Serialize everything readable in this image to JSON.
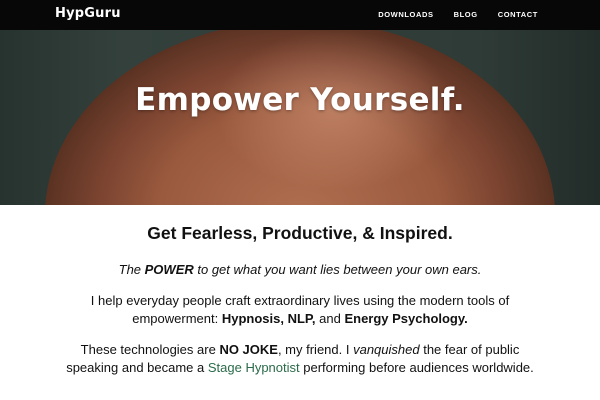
{
  "navbar": {
    "brand": "HypGuru",
    "links": [
      "DOWNLOADS",
      "BLOG",
      "CONTACT"
    ]
  },
  "hero": {
    "title": "Empower Yourself."
  },
  "main": {
    "headline": "Get Fearless, Productive, & Inspired.",
    "tagline": {
      "pre": "The ",
      "bold": "POWER",
      "post": " to get what you want lies between your own ears."
    },
    "intro": {
      "pre": "I help everyday people craft extraordinary lives using the modern tools of empowerment: ",
      "tool1": "Hypnosis, NLP,",
      "mid": " and ",
      "tool2": "Energy Psychology."
    },
    "story": {
      "pre": "These technologies are ",
      "bold": "NO JOKE",
      "mid1": ", my friend. I ",
      "italic": "vanquished",
      "mid2": " the fear of public speaking and became a ",
      "link": "Stage Hypnotist",
      "post": " performing before audiences worldwide."
    }
  },
  "colors": {
    "navbar_bg": "#070707",
    "link": "#2b6b4a"
  }
}
